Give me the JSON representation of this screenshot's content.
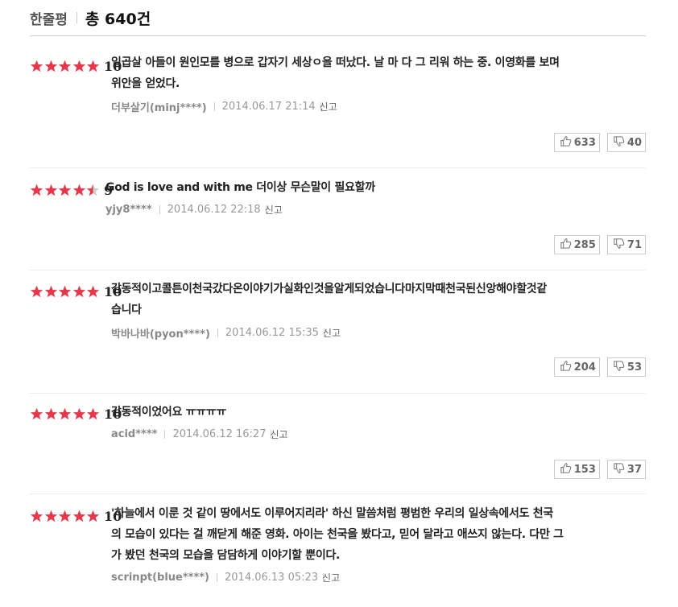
{
  "header": {
    "title": "한줄평",
    "total_prefix": "총",
    "total_count": "640건"
  },
  "colors": {
    "star_on": "#e8374a",
    "star_off": "#cccccc"
  },
  "reviews": [
    {
      "rating": 5,
      "score": "10",
      "lines": [
        "일곱살 아들이 원인모를 병으로 갑자기 세상ㅇ을 떠났다. 날 마 다 그 리워 하는 중. 이영화를 보며",
        "위안을 얻었다."
      ],
      "user": "더부살기(minj****)",
      "date": "2014.06.17 21:14",
      "report": "신고",
      "likes": "633",
      "dislikes": "40"
    },
    {
      "rating": 4.5,
      "score": "9",
      "lines": [
        "God is love and with me 더이상 무슨말이 필요할까"
      ],
      "user": "yjy8****",
      "date": "2014.06.12 22:18",
      "report": "신고",
      "likes": "285",
      "dislikes": "71"
    },
    {
      "rating": 5,
      "score": "10",
      "lines": [
        "감동적이고콜튼이천국갔다온이야기가실화인것을알게되었습니다마지막때천국된신앙해야할것같",
        "습니다"
      ],
      "user": "박바나바(pyon****)",
      "date": "2014.06.12 15:35",
      "report": "신고",
      "likes": "204",
      "dislikes": "53"
    },
    {
      "rating": 5,
      "score": "10",
      "lines": [
        "감동적이었어요 ㅠㅠㅠㅠ"
      ],
      "user": "acid****",
      "date": "2014.06.12 16:27",
      "report": "신고",
      "likes": "153",
      "dislikes": "37"
    },
    {
      "rating": 5,
      "score": "10",
      "lines": [
        "'하늘에서 이룬 것 같이 땅에서도 이루어지리라' 하신 말씀처럼 평범한 우리의 일상속에서도 천국",
        "의 모습이 있다는 걸 깨닫게 해준 영화. 아이는 천국을 봤다고, 믿어 달라고 애쓰지 않는다. 다만 그",
        "가 봤던 천국의 모습을 담담하게 이야기할 뿐이다."
      ],
      "user": "scrinpt(blue****)",
      "date": "2014.06.13 05:23",
      "report": "신고",
      "likes": "",
      "dislikes": ""
    }
  ]
}
